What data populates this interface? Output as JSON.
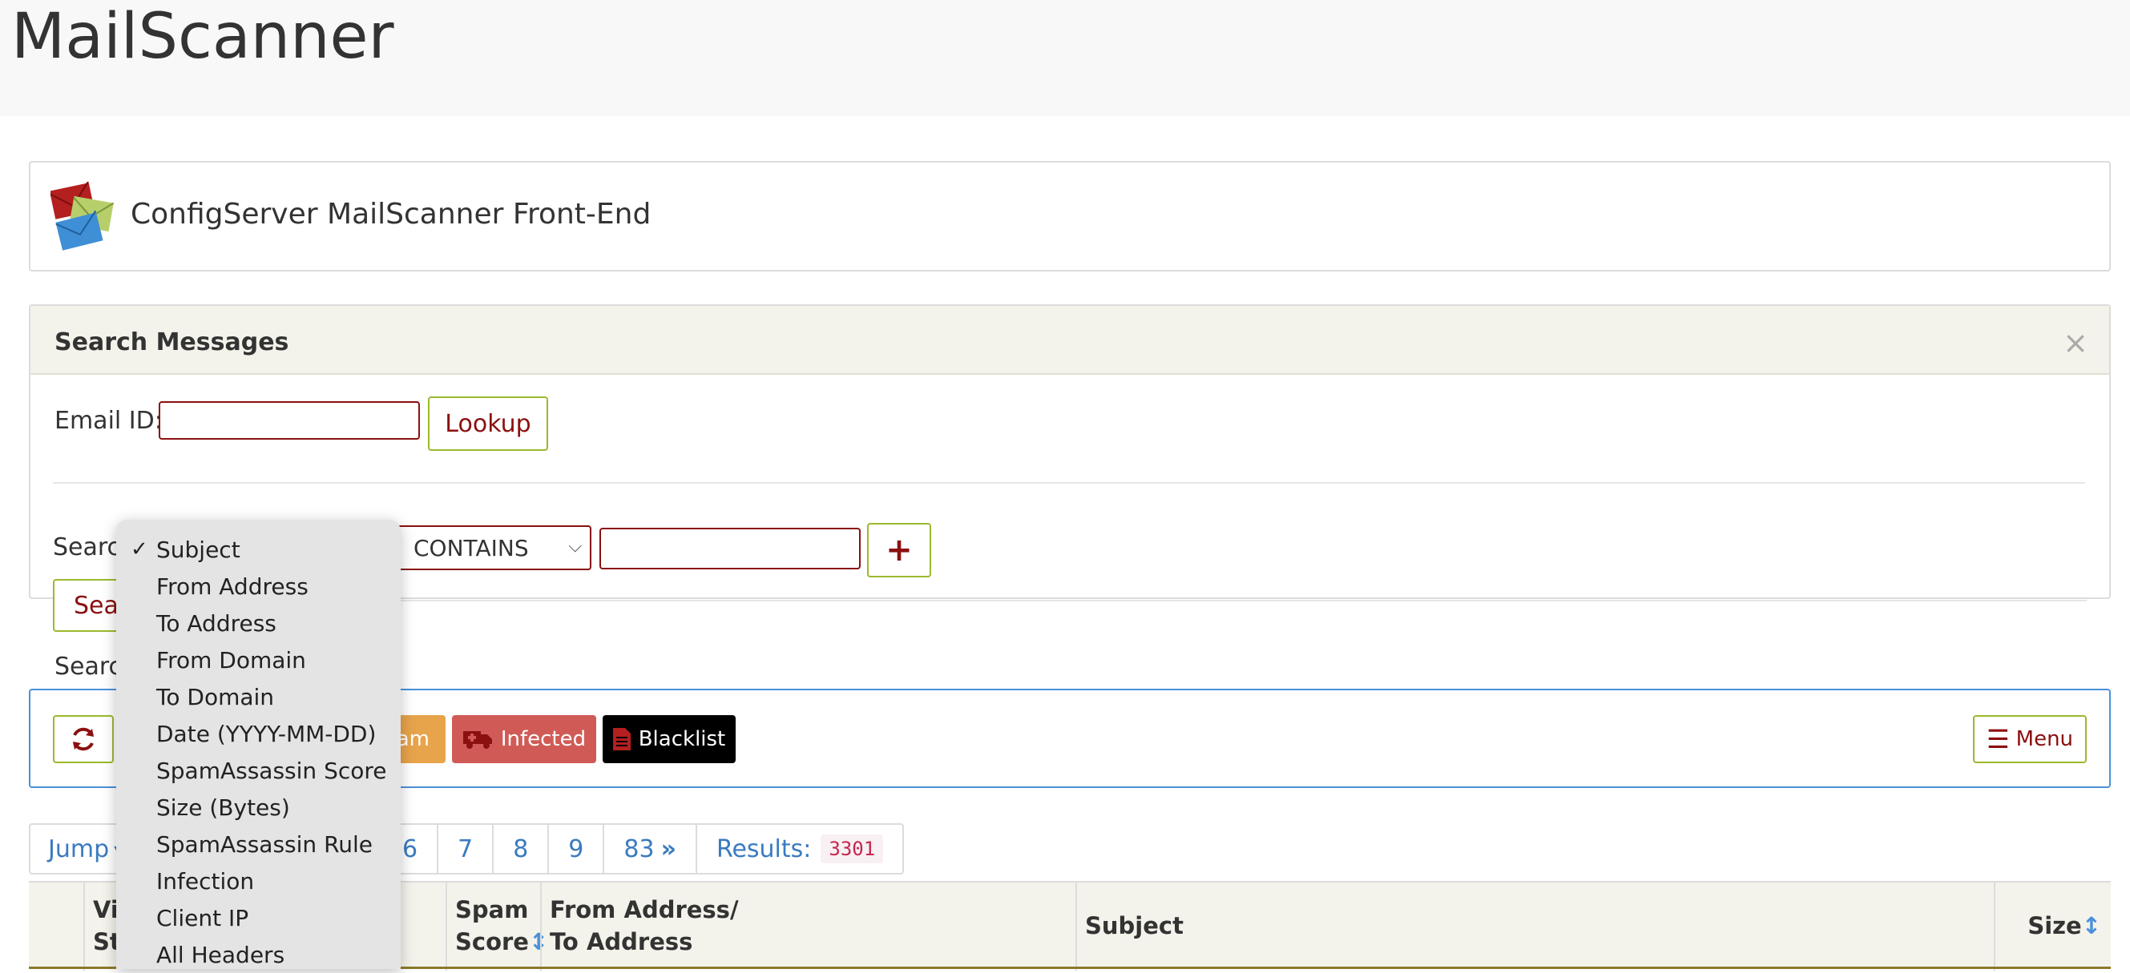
{
  "app": {
    "title": "MailScanner"
  },
  "header": {
    "title": "ConfigServer MailScanner Front-End"
  },
  "search": {
    "heading": "Search Messages",
    "close": "×",
    "email_id_label": "Email ID:",
    "email_id_value": "",
    "lookup_label": "Lookup",
    "search_label": "Search",
    "field_selected": "Subject",
    "operator_selected": "CONTAINS",
    "term_value": "",
    "add_label": "+",
    "search_button_label": "Sear"
  },
  "dropdown": {
    "options": [
      {
        "label": "Subject",
        "checked": true
      },
      {
        "label": "From Address",
        "checked": false
      },
      {
        "label": "To Address",
        "checked": false
      },
      {
        "label": "From Domain",
        "checked": false
      },
      {
        "label": "To Domain",
        "checked": false
      },
      {
        "label": "Date (YYYY-MM-DD)",
        "checked": false
      },
      {
        "label": "SpamAssassin Score",
        "checked": false
      },
      {
        "label": "Size (Bytes)",
        "checked": false
      },
      {
        "label": "SpamAssassin Rule",
        "checked": false
      },
      {
        "label": "Infection",
        "checked": false
      },
      {
        "label": "Client IP",
        "checked": false
      },
      {
        "label": "All Headers",
        "checked": false
      }
    ],
    "check_glyph": "✓"
  },
  "toolbar": {
    "spam_label": "am",
    "infected_label": "Infected",
    "blacklist_label": "Blacklist",
    "menu_label": "Menu"
  },
  "pager": {
    "jump_label": "Jump",
    "pages": [
      "6",
      "7",
      "8",
      "9"
    ],
    "last_page": "83",
    "results_label": "Results:",
    "results_count": "3301"
  },
  "table": {
    "col_view_status": [
      "Vi",
      "St"
    ],
    "col_spam_score": [
      "Spam",
      "Score"
    ],
    "col_from_to": [
      "From Address/",
      "To Address"
    ],
    "col_subject": "Subject",
    "col_size": "Size"
  },
  "colors": {
    "brand_red": "#8b1010",
    "accent_green": "#9bb92e",
    "link_blue": "#3a7bbf",
    "spam_orange": "#e7a44b",
    "infected_red": "#d05b56",
    "blacklist_black": "#000000"
  }
}
